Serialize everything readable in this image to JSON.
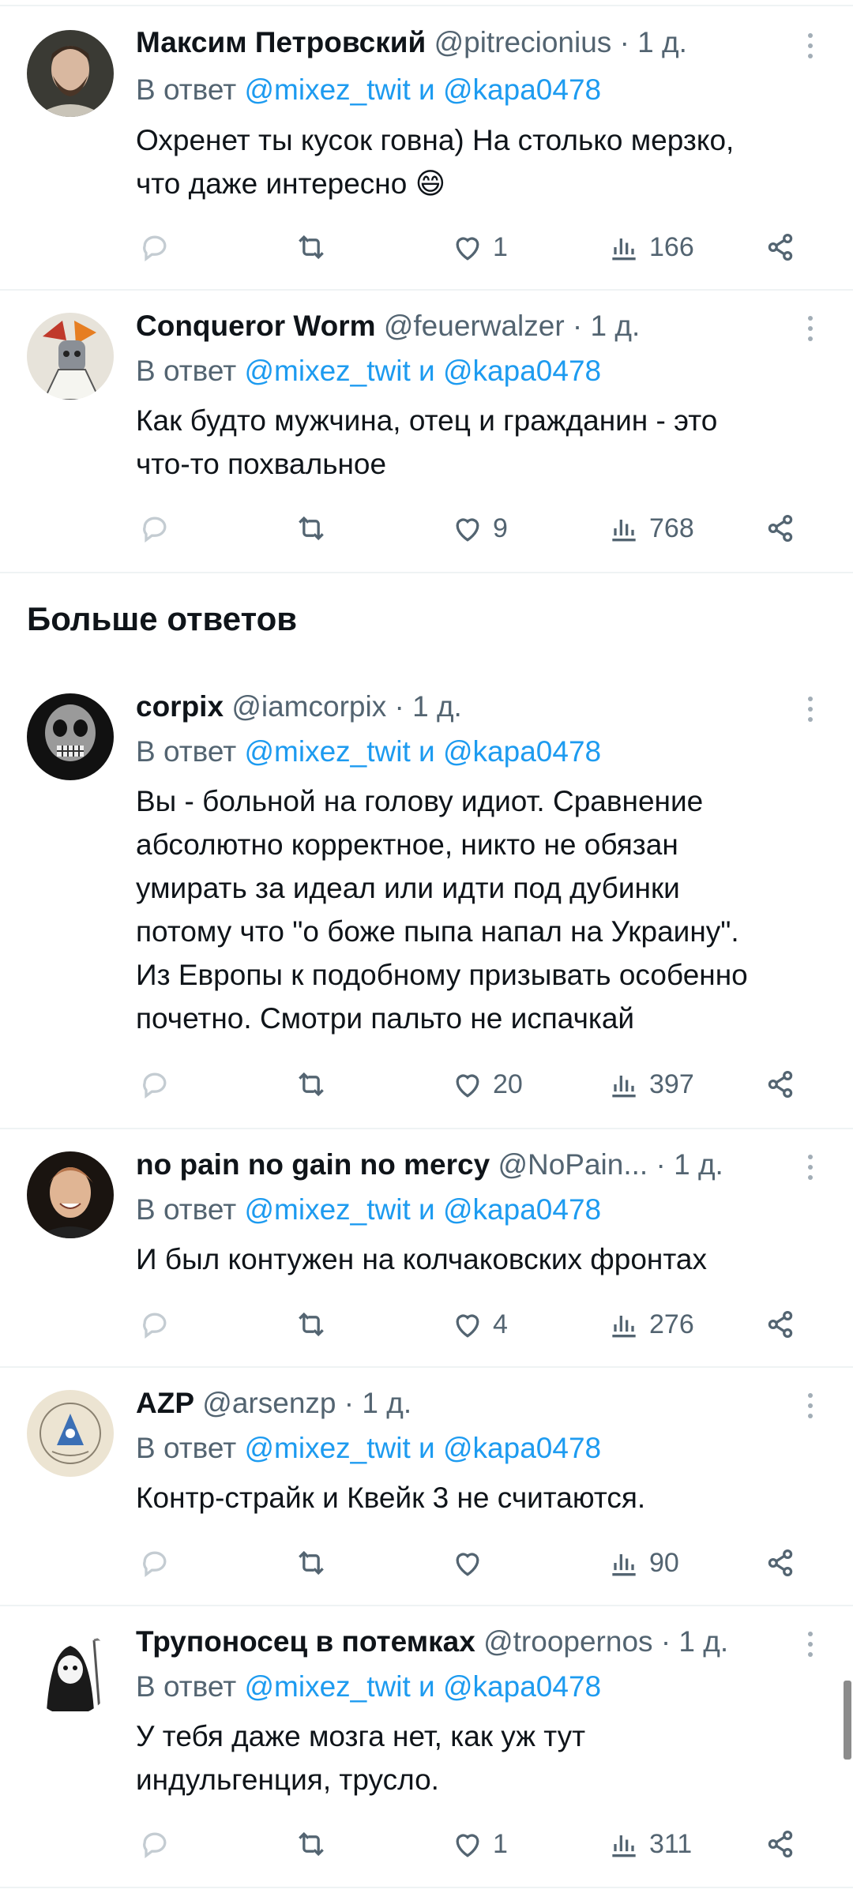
{
  "section_title": "Больше ответов",
  "reply_prefix": "В ответ",
  "reply_joiner": "и",
  "tweets": [
    {
      "name": "Максим Петровский",
      "handle": "@pitrecionius",
      "sep": "·",
      "time": "1 д.",
      "mention1": "@mixez_twit",
      "mention2": "@kapa0478",
      "lines": [
        "Охренет ты кусок говна) На столько мерзко,",
        "что даже интересно 😄"
      ],
      "likes": "1",
      "views": "166",
      "avatar": "man-beard"
    },
    {
      "name": "Conqueror Worm",
      "handle": "@feuerwalzer",
      "sep": "·",
      "time": "1 д.",
      "mention1": "@mixez_twit",
      "mention2": "@kapa0478",
      "lines": [
        "Как будто мужчина, отец и гражданин - это",
        "что-то похвальное"
      ],
      "likes": "9",
      "views": "768",
      "avatar": "art-figure"
    },
    {
      "name": "corpix",
      "handle": "@iamcorpix",
      "sep": "·",
      "time": "1 д.",
      "mention1": "@mixez_twit",
      "mention2": "@kapa0478",
      "lines": [
        "Вы - больной на голову идиот. Сравнение",
        "абсолютно корректное, никто не обязан",
        "умирать за идеал или идти под дубинки",
        "потому что \"о боже пыпа напал на Украину\".",
        "Из Европы к подобному призывать особенно",
        "почетно. Смотри пальто не испачкай"
      ],
      "likes": "20",
      "views": "397",
      "avatar": "skull"
    },
    {
      "name": "no pain no gain no mercy",
      "handle": "@NoPain...",
      "sep": "·",
      "time": "1 д.",
      "mention1": "@mixez_twit",
      "mention2": "@kapa0478",
      "lines": [
        "И был контужен на колчаковских фронтах"
      ],
      "likes": "4",
      "views": "276",
      "avatar": "man-smile"
    },
    {
      "name": "AZP",
      "handle": "@arsenzp",
      "sep": "·",
      "time": "1 д.",
      "mention1": "@mixez_twit",
      "mention2": "@kapa0478",
      "lines": [
        "Контр-страйк и Квейк 3 не считаются."
      ],
      "likes": "",
      "views": "90",
      "avatar": "emblem"
    },
    {
      "name": "Трупоносец в потемках",
      "handle": "@troopernos",
      "sep": "·",
      "time": "1 д.",
      "mention1": "@mixez_twit",
      "mention2": "@kapa0478",
      "lines": [
        "У тебя даже мозга нет, как уж тут",
        "индульгенция, трусло."
      ],
      "likes": "1",
      "views": "311",
      "avatar": "grim-reaper"
    }
  ],
  "icons": [
    "reply-icon",
    "retweet-icon",
    "like-icon",
    "views-icon",
    "share-icon",
    "more-icon"
  ]
}
